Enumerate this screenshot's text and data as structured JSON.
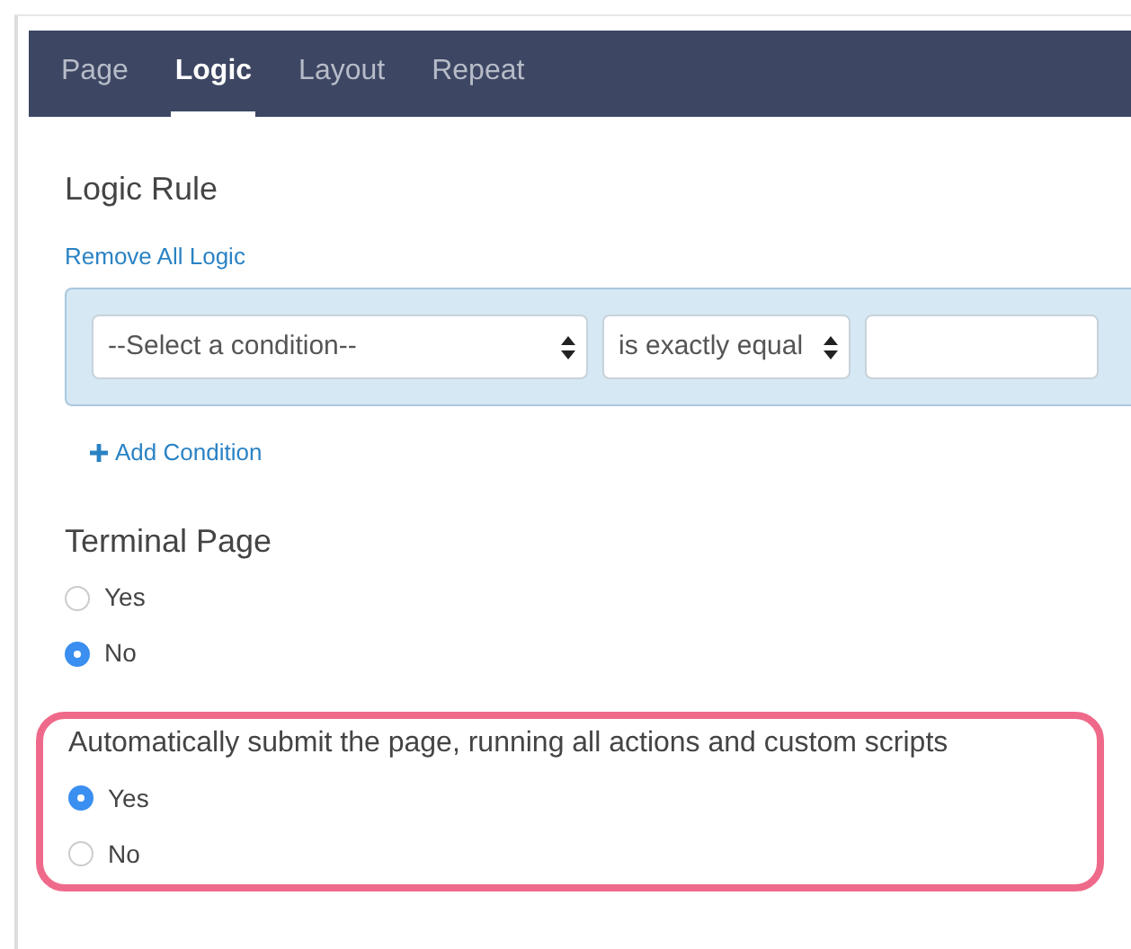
{
  "tabs": [
    {
      "label": "Page",
      "selected": false
    },
    {
      "label": "Logic",
      "selected": true
    },
    {
      "label": "Layout",
      "selected": false
    },
    {
      "label": "Repeat",
      "selected": false
    }
  ],
  "logic_rule": {
    "title": "Logic Rule",
    "remove_link": "Remove All Logic",
    "condition_select": "--Select a condition--",
    "operator_select": "is exactly equal",
    "add_link": "Add Condition"
  },
  "radio_groups": [
    {
      "title": "Terminal Page",
      "highlighted": false,
      "options": [
        {
          "label": "Yes",
          "selected": false
        },
        {
          "label": "No",
          "selected": true
        }
      ]
    },
    {
      "title": "Automatically submit the page, running all actions and custom scripts",
      "highlighted": true,
      "options": [
        {
          "label": "Yes",
          "selected": true
        },
        {
          "label": "No",
          "selected": false
        }
      ]
    }
  ]
}
